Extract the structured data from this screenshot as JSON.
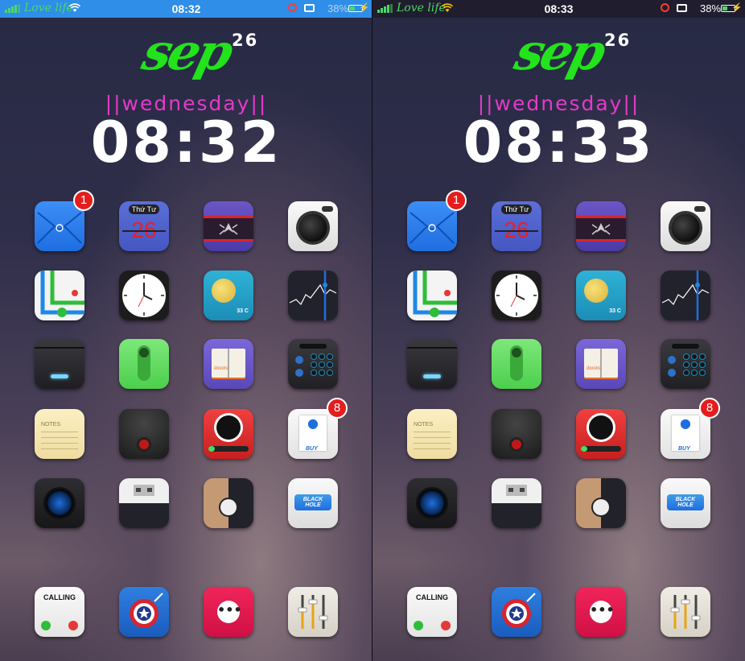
{
  "screens": [
    {
      "status": {
        "carrier": "Love life",
        "time": "08:32",
        "battery": "38%"
      },
      "date": {
        "month": "sep",
        "day": "26",
        "weekday": "||wednesday||"
      },
      "clock": "08:32",
      "badges": {
        "mail": "1",
        "store": "8"
      },
      "calendar": {
        "weekday": "Thứ Tư",
        "day": "26"
      },
      "weather_temp": "33 C",
      "ibooks": "ibooks",
      "notes": "NOTES",
      "buy": "BUY",
      "blackhole": "BLACK HOLE",
      "calling": "CALLING"
    },
    {
      "status": {
        "carrier": "Love life",
        "time": "08:33",
        "battery": "38%"
      },
      "date": {
        "month": "sep",
        "day": "26",
        "weekday": "||wednesday||"
      },
      "clock": "08:33",
      "badges": {
        "mail": "1",
        "store": "8"
      },
      "calendar": {
        "weekday": "Thứ Tư",
        "day": "26"
      },
      "weather_temp": "33 C",
      "ibooks": "ibooks",
      "notes": "NOTES",
      "buy": "BUY",
      "blackhole": "BLACK HOLE",
      "calling": "CALLING"
    }
  ],
  "colors": {
    "accent_green": "#22e31c",
    "weekday_pink": "#e43ac9",
    "badge_red": "#e41d1d",
    "status_blue": "#2f8ee8"
  },
  "icons": [
    "mail-icon",
    "calendar-icon",
    "spider-icon",
    "camera-icon",
    "maps-icon",
    "clock-icon",
    "weather-icon",
    "stocks-icon",
    "wallet-icon",
    "toggle-icon",
    "ibooks-icon",
    "calculator-icon",
    "notes-icon",
    "voice-memo-icon",
    "darth-vader-icon",
    "app-store-icon",
    "camera-lens-icon",
    "usb-icon",
    "zipper-icon",
    "blackhole-icon",
    "phone-icon",
    "shield-icon",
    "messages-icon",
    "settings-icon"
  ]
}
